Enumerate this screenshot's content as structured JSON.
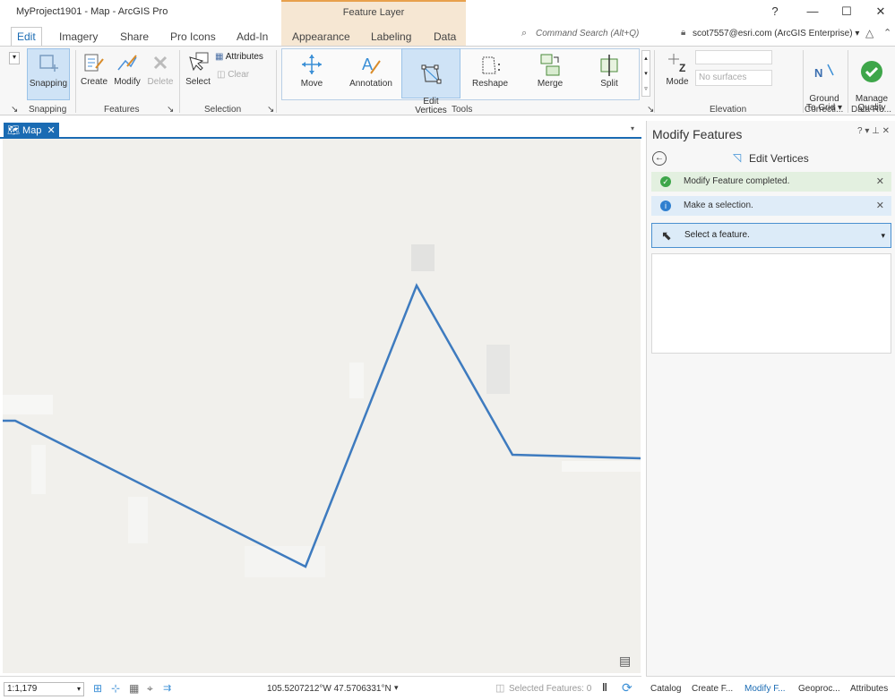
{
  "app": {
    "title": "MyProject1901 - Map - ArcGIS Pro",
    "context_group": "Feature Layer",
    "help": "?",
    "minimize": "—",
    "maximize": "☐",
    "close": "✕"
  },
  "tabs": [
    "Edit",
    "Imagery",
    "Share",
    "Pro Icons",
    "Add-In",
    "Appearance",
    "Labeling",
    "Data"
  ],
  "command_search": "Command Search (Alt+Q)",
  "user": "scot7557@esri.com (ArcGIS Enterprise) ▾",
  "ribbon": {
    "snapping": "Snapping",
    "create": "Create",
    "modify": "Modify",
    "delete": "Delete",
    "select": "Select",
    "attributes": "Attributes",
    "clear": "Clear",
    "move": "Move",
    "annotation": "Annotation",
    "edit_vertices": "Edit\nVertices",
    "reshape": "Reshape",
    "merge": "Merge",
    "split": "Split",
    "mode": "Mode",
    "surfaces": "No surfaces",
    "ground_to_grid": "Ground\nTo Grid ▾",
    "manage_quality": "Manage\nQuality",
    "groups": {
      "snapping": "Snapping",
      "features": "Features",
      "selection": "Selection",
      "tools": "Tools",
      "elevation": "Elevation",
      "corrections": "Correcti...",
      "data_reviewer": "Data Re..."
    }
  },
  "map": {
    "tab_label": "Map",
    "scale": "1:1,179",
    "coordinates": "105.5207212°W 47.5706331°N",
    "selected_features": "Selected Features: 0"
  },
  "pane": {
    "title": "Modify Features",
    "controls": "? ▾ ⊥ ✕",
    "tool_title": "Edit Vertices",
    "msg_ok": "Modify Feature completed.",
    "msg_info": "Make a selection.",
    "select_prompt": "Select a feature."
  },
  "bottom_tabs": [
    "Catalog",
    "Create F...",
    "Modify F...",
    "Geoproc...",
    "Attributes"
  ]
}
